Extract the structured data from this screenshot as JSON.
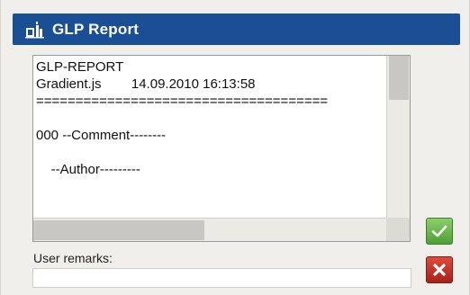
{
  "window": {
    "title": "GLP Report",
    "title_icon": "report-chart-icon",
    "titlebar_color": "#1a4f96"
  },
  "report": {
    "lines": [
      "GLP-REPORT",
      "Gradient.js        14.09.2010 16:13:58",
      "=====================================",
      "",
      "000 --Comment--------",
      "",
      "    --Author---------"
    ]
  },
  "remarks": {
    "label": "User remarks:",
    "value": ""
  },
  "buttons": {
    "ok_icon": "checkmark-icon",
    "cancel_icon": "close-x-icon",
    "ok_color": "#4f9f36",
    "cancel_color": "#a8211a"
  }
}
